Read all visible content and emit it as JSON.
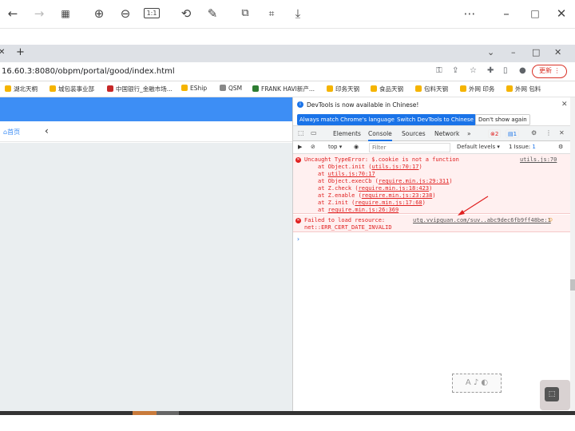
{
  "viewer_toolbar": {
    "icons": [
      "back-arrow-icon",
      "forward-arrow-icon",
      "grid-icon",
      "zoom-in-icon",
      "zoom-out-icon",
      "actual-size-icon",
      "rotate-icon",
      "edit-icon",
      "crop-icon",
      "ocr-icon",
      "download-icon",
      "more-icon",
      "minimize-icon",
      "maximize-icon",
      "close-icon"
    ],
    "actual_size_label": "1:1"
  },
  "browser": {
    "url": "16.60.3:8080/obpm/portal/good/index.html",
    "update_label": "更新",
    "bookmarks": [
      {
        "label": "湖北天桐",
        "color": "#f5b400"
      },
      {
        "label": "城包装事业部",
        "color": "#f5b400"
      },
      {
        "label": "中国银行_金融市场...",
        "color": "#c62828"
      },
      {
        "label": "EShip",
        "color": "#f5b400"
      },
      {
        "label": "QSM",
        "color": "#888888"
      },
      {
        "label": "FRANK HAVI新产...",
        "color": "#2e7d32"
      },
      {
        "label": "印务天钢",
        "color": "#f5b400"
      },
      {
        "label": "食品天钢",
        "color": "#f5b400"
      },
      {
        "label": "包料天钢",
        "color": "#f5b400"
      },
      {
        "label": "外网 印务",
        "color": "#f5b400"
      },
      {
        "label": "外网 包料",
        "color": "#f5b400"
      }
    ]
  },
  "page": {
    "home_label": "首页",
    "back_icon": "chevron-left-icon"
  },
  "devtools": {
    "notice": "DevTools is now available in Chinese!",
    "notice_buttons": [
      "Always match Chrome's language",
      "Switch DevTools to Chinese",
      "Don't show again"
    ],
    "tabs": [
      "Elements",
      "Console",
      "Sources",
      "Network"
    ],
    "active_tab": "Console",
    "more_tabs": "»",
    "error_count": "2",
    "message_count": "1",
    "context": "top",
    "filter_placeholder": "Filter",
    "levels": "Default levels",
    "issues": "1 Issue:",
    "issues_count": "1",
    "errors": [
      {
        "message": "Uncaught TypeError: $.cookie is not a function",
        "source": "utils.js:70",
        "stack": [
          {
            "text": "at Object.init (",
            "link": "utils.js:70:17",
            "close": ")"
          },
          {
            "text": "at ",
            "link": "utils.js:70:17",
            "close": ""
          },
          {
            "text": "at Object.execCb (",
            "link": "require.min.js:29:311",
            "close": ")"
          },
          {
            "text": "at Z.check (",
            "link": "require.min.js:18:423",
            "close": ")"
          },
          {
            "text": "at Z.enable (",
            "link": "require.min.js:23:238",
            "close": ")"
          },
          {
            "text": "at Z.init (",
            "link": "require.min.js:17:68",
            "close": ")"
          },
          {
            "text": "at ",
            "link": "require.min.js:26:369",
            "close": ""
          }
        ]
      },
      {
        "message_line1": "Failed to load resource:",
        "message_line2": "net::ERR_CERT_DATE_INVALID",
        "source": "utq.vvipquan.com/suv..abc9dec6fb9ff48be:1"
      }
    ],
    "prompt": "›"
  },
  "colors": {
    "accent_blue": "#3d8ef5",
    "error_red": "#e02020"
  }
}
